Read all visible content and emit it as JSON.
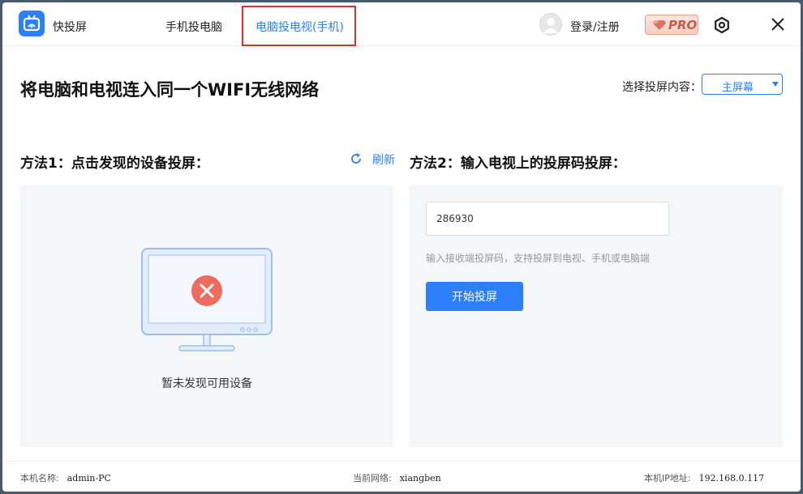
{
  "app": {
    "name": "快投屏"
  },
  "tabs": [
    {
      "label": "手机投电脑",
      "active": false
    },
    {
      "label": "电脑投电视(手机)",
      "active": true
    }
  ],
  "header": {
    "login_label": "登录/注册",
    "pro_label": "PRO"
  },
  "icons": {
    "logo": "tv-logo-icon",
    "avatar": "user-avatar-icon",
    "pro": "diamond-icon",
    "settings": "settings-icon",
    "close": "close-icon",
    "refresh": "refresh-icon",
    "monitor": "monitor-error-icon",
    "dropdown": "chevron-down-icon"
  },
  "colors": {
    "accent": "#2d7ff9",
    "error": "#ef6b5e",
    "highlight_box": "#e0302a"
  },
  "main": {
    "title": "将电脑和电视连入同一个WIFI无线网络",
    "select": {
      "label": "选择投屏内容：",
      "value": "主屏幕"
    },
    "method1": {
      "title": "方法1：点击发现的设备投屏：",
      "refresh_label": "刷新",
      "empty_text": "暂未发现可用设备"
    },
    "method2": {
      "title": "方法2：输入电视上的投屏码投屏：",
      "code_value": "286930",
      "hint": "输入接收端投屏码，支持投屏到电视、手机或电脑端",
      "button_label": "开始投屏"
    }
  },
  "footer": {
    "hostname_label": "本机名称:",
    "hostname_value": "admin-PC",
    "network_label": "当前网络:",
    "network_value": "xiangben",
    "ip_label": "本机IP地址:",
    "ip_value": "192.168.0.117"
  }
}
